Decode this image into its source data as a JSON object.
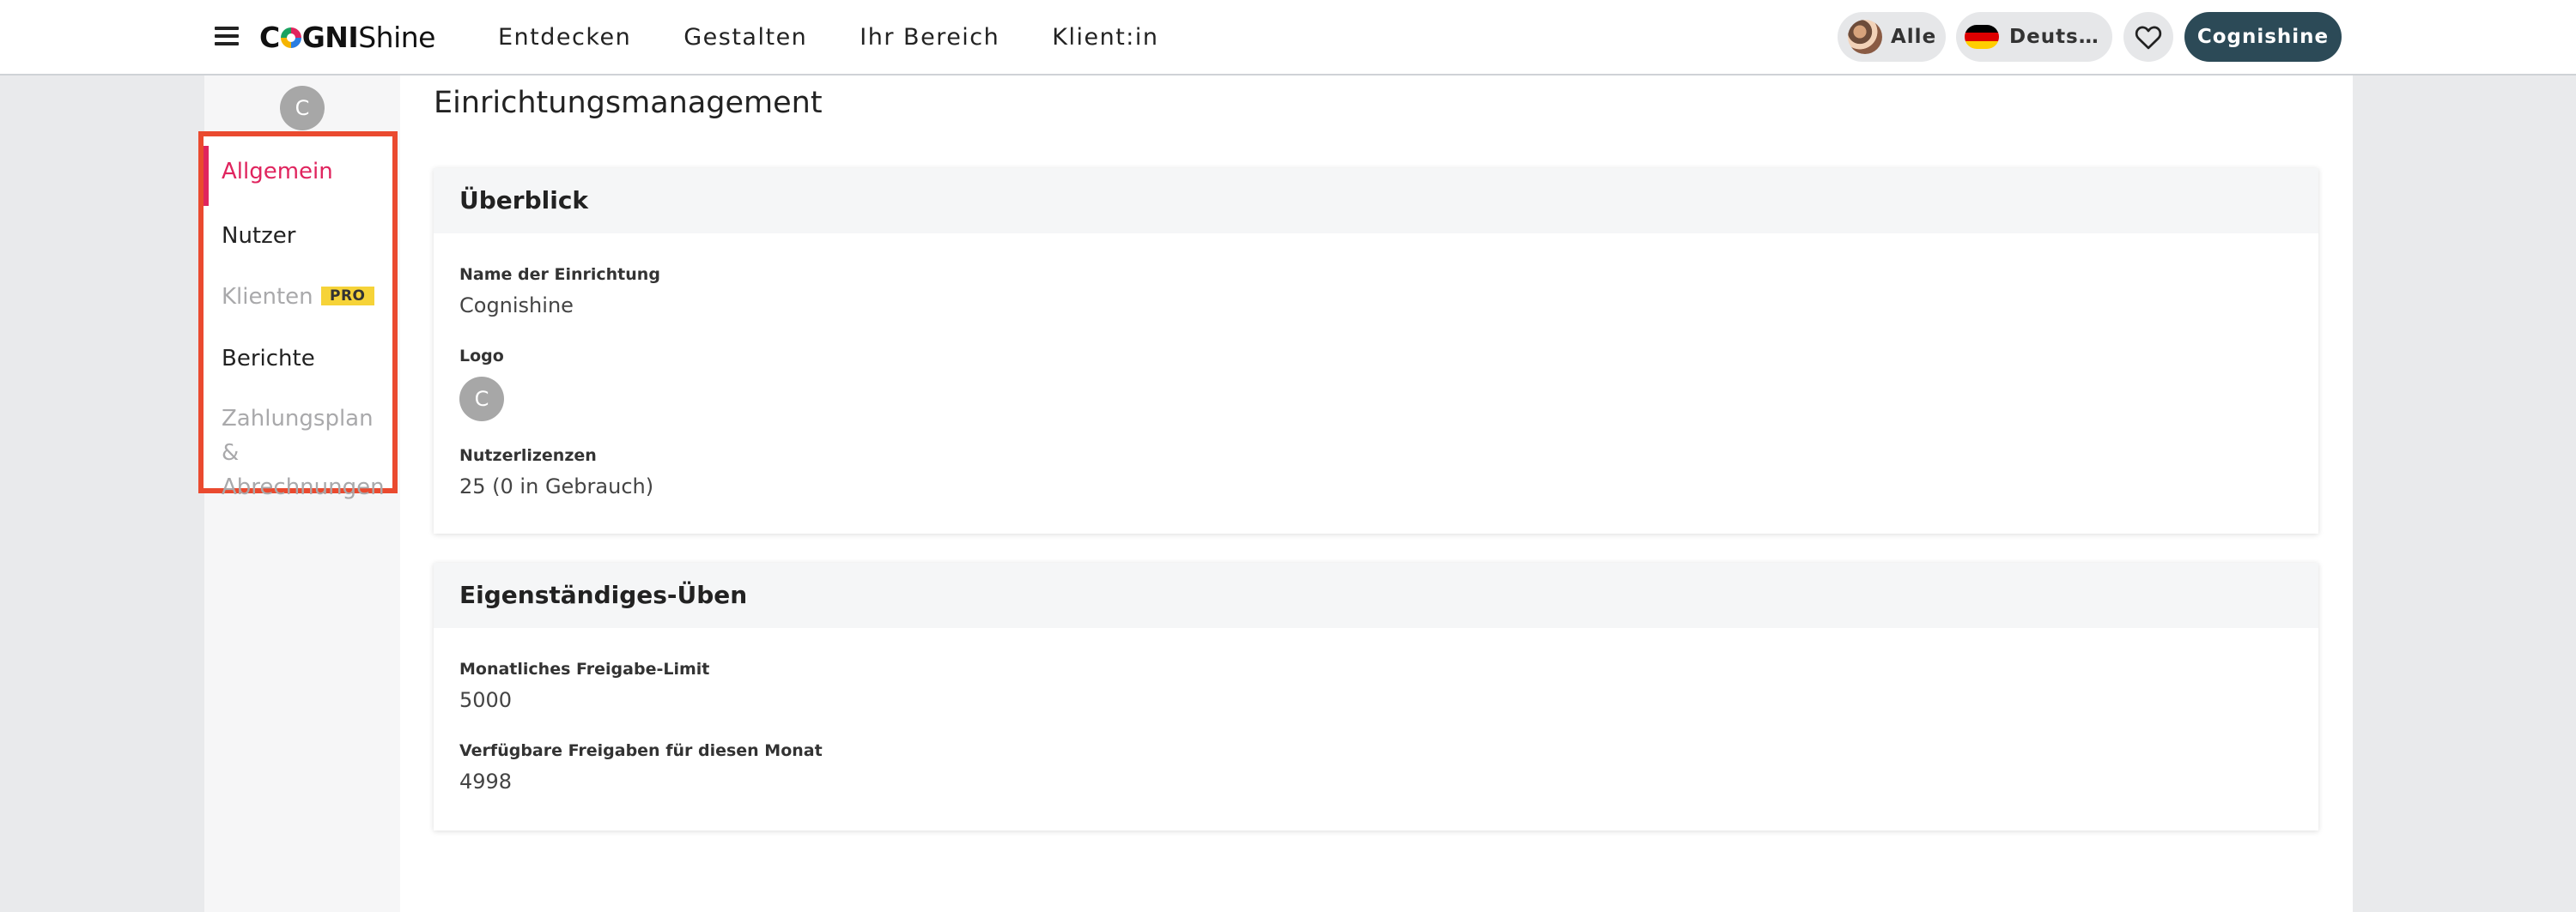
{
  "header": {
    "logo_prefix": "C",
    "logo_mid": "GNI",
    "logo_suffix": "Shine",
    "nav": [
      "Entdecken",
      "Gestalten",
      "Ihr Bereich",
      "Klient:in"
    ],
    "filter_all": "Alle",
    "language": "Deuts…",
    "user_button": "Cognishine"
  },
  "sidebar": {
    "avatar_initial": "C",
    "items": [
      {
        "label": "Allgemein",
        "state": "active"
      },
      {
        "label": "Nutzer",
        "state": "normal"
      },
      {
        "label": "Klienten",
        "state": "disabled",
        "badge": "PRO"
      },
      {
        "label": "Berichte",
        "state": "normal"
      },
      {
        "label": "Zahlungsplan & Abrechnungen",
        "state": "disabled"
      }
    ]
  },
  "main": {
    "title": "Einrichtungsmanagement",
    "overview": {
      "heading": "Überblick",
      "name_label": "Name der Einrichtung",
      "name_value": "Cognishine",
      "logo_label": "Logo",
      "logo_initial": "C",
      "licenses_label": "Nutzerlizenzen",
      "licenses_value": "25 (0 in Gebrauch)"
    },
    "practice": {
      "heading": "Eigenständiges-Üben",
      "limit_label": "Monatliches Freigabe-Limit",
      "limit_value": "5000",
      "available_label": "Verfügbare Freigaben für diesen Monat",
      "available_value": "4998"
    }
  },
  "colors": {
    "accent": "#e0245e",
    "highlight_border": "#ea4a2f",
    "user_button_bg": "#2c4a57",
    "pro_badge": "#f6d338",
    "flag": [
      "#000000",
      "#dd0000",
      "#ffce00"
    ]
  },
  "icons": {
    "menu": "hamburger-icon",
    "favorites": "heart-icon",
    "language": "german-flag-icon"
  }
}
